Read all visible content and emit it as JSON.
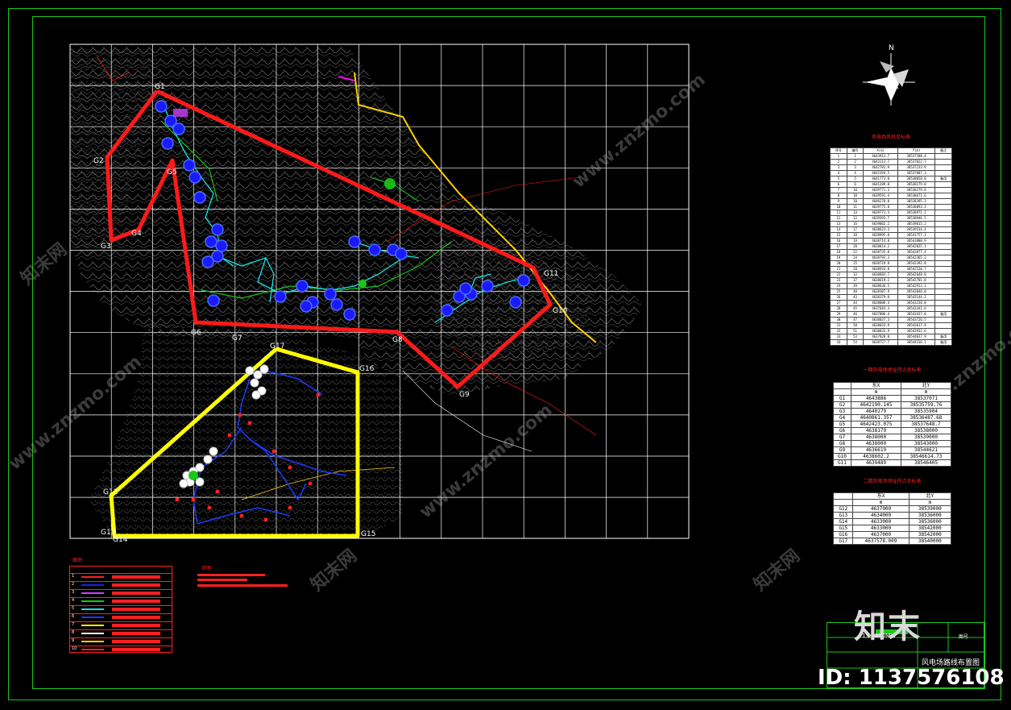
{
  "drawing": {
    "title": "风电场路线布置图",
    "corner_label": "图号",
    "scale_note": "1:10000MW"
  },
  "watermark": {
    "logo_text": "知末",
    "id_text": "ID: 1137576108",
    "site_text": "www.znzmo.com",
    "brand_text": "知末网"
  },
  "compass": {
    "north_label": "N"
  },
  "map_points": [
    {
      "id": "G1",
      "label": "G1"
    },
    {
      "id": "G2",
      "label": "G2"
    },
    {
      "id": "G3",
      "label": "G3"
    },
    {
      "id": "G4",
      "label": "G4"
    },
    {
      "id": "G5",
      "label": "G5"
    },
    {
      "id": "G6",
      "label": "G6"
    },
    {
      "id": "G7",
      "label": "G7"
    },
    {
      "id": "G8",
      "label": "G8"
    },
    {
      "id": "G9",
      "label": "G9"
    },
    {
      "id": "G10",
      "label": "G10"
    },
    {
      "id": "G11",
      "label": "G11"
    },
    {
      "id": "G12",
      "label": "G12"
    },
    {
      "id": "G13",
      "label": "G13"
    },
    {
      "id": "G14",
      "label": "G14"
    },
    {
      "id": "G15",
      "label": "G15"
    },
    {
      "id": "G16",
      "label": "G16"
    },
    {
      "id": "G17",
      "label": "G17"
    }
  ],
  "table1": {
    "title": "风电场风机坐标表",
    "headers": [
      "序号",
      "编号",
      "X(m)",
      "Y(m)",
      "备注"
    ],
    "rows": [
      [
        "1",
        "1",
        "4643913.7",
        "38537188.4",
        ""
      ],
      [
        "2",
        "2",
        "4643113.7",
        "38537022.7",
        ""
      ],
      [
        "3",
        "3",
        "4642781.9",
        "38537233.9",
        ""
      ],
      [
        "4",
        "4",
        "4642394.5",
        "38537807.3",
        ""
      ],
      [
        "5",
        "5",
        "4641773.0",
        "38538058.0",
        "备用"
      ],
      [
        "6",
        "6",
        "4641289.8",
        "38538179.0",
        ""
      ],
      [
        "7",
        "10",
        "4639771.3",
        "38538279.8",
        ""
      ],
      [
        "8",
        "10",
        "4639591.4",
        "38538671.6",
        ""
      ],
      [
        "9",
        "10",
        "4640270.0",
        "38538395.3",
        ""
      ],
      [
        "10",
        "11",
        "4639775.0",
        "38538893.3",
        ""
      ],
      [
        "11",
        "14",
        "4639771.3",
        "38538971.2",
        ""
      ],
      [
        "12",
        "12",
        "4639393.7",
        "38538946.5",
        ""
      ],
      [
        "13",
        "16",
        "4639002.2",
        "38539015.2",
        ""
      ],
      [
        "14",
        "17",
        "4638623.3",
        "38539534.4",
        ""
      ],
      [
        "15",
        "18",
        "4638995.0",
        "38541757.3",
        ""
      ],
      [
        "16",
        "19",
        "4638714.8",
        "38541800.9",
        ""
      ],
      [
        "17",
        "20",
        "4638814.2",
        "38542025.1",
        ""
      ],
      [
        "18",
        "22",
        "4638735.0",
        "38542077.4",
        ""
      ],
      [
        "19",
        "24",
        "4638793.3",
        "38542365.2",
        ""
      ],
      [
        "20",
        "25",
        "4638719.8",
        "38542392.8",
        ""
      ],
      [
        "21",
        "28",
        "4638933.8",
        "38542528.7",
        ""
      ],
      [
        "22",
        "33",
        "4638683.7",
        "38542648.8",
        ""
      ],
      [
        "23",
        "37",
        "4638619.2",
        "38542701.0",
        ""
      ],
      [
        "24",
        "39",
        "4638636.5",
        "38542913.1",
        ""
      ],
      [
        "25",
        "40",
        "4638307.9",
        "38543046.0",
        ""
      ],
      [
        "26",
        "43",
        "4638379.0",
        "38543144.2",
        ""
      ],
      [
        "27",
        "44",
        "4638008.4",
        "38543238.0",
        ""
      ],
      [
        "28",
        "45",
        "4637683.3",
        "38543341.6",
        ""
      ],
      [
        "29",
        "46",
        "4637806.4",
        "38543437.0",
        "备用"
      ],
      [
        "30",
        "47",
        "4638037.3",
        "38543726.5",
        ""
      ],
      [
        "31",
        "50",
        "4638033.9",
        "38543817.9",
        ""
      ],
      [
        "32",
        "51",
        "4638033.9",
        "38543932.6",
        ""
      ],
      [
        "33",
        "53",
        "4637828.0",
        "38544037.9",
        "备用"
      ],
      [
        "34",
        "54",
        "4638727.7",
        "38544316.1",
        "备用"
      ]
    ]
  },
  "table2": {
    "title": "一期风电场场址拐点坐标表",
    "headers": [
      "",
      "东X",
      "北Y"
    ],
    "units": [
      "",
      "m",
      "m"
    ],
    "rows": [
      [
        "G1",
        "4643886",
        "38537071"
      ],
      [
        "G2",
        "4642190.145",
        "38535759.76"
      ],
      [
        "G3",
        "4640279",
        "38535904"
      ],
      [
        "G4",
        "4640861.357",
        "38536487.68"
      ],
      [
        "G5",
        "4642423.075",
        "38537648.7"
      ],
      [
        "G6",
        "4638179",
        "38538000"
      ],
      [
        "G7",
        "4638000",
        "38539000"
      ],
      [
        "G8",
        "4638000",
        "38543000"
      ],
      [
        "G9",
        "4636619",
        "38544621"
      ],
      [
        "G10",
        "4638602.2",
        "38546614.73"
      ],
      [
        "G11",
        "4639489",
        "38546405"
      ]
    ]
  },
  "table3": {
    "title": "二期风电场场址拐点坐标表",
    "headers": [
      "",
      "东X",
      "北Y"
    ],
    "units": [
      "",
      "m",
      "m"
    ],
    "rows": [
      [
        "G12",
        "4637000",
        "38539000"
      ],
      [
        "G13",
        "4634000",
        "38536000"
      ],
      [
        "G14",
        "4633000",
        "38536000"
      ],
      [
        "G15",
        "4633000",
        "38542000"
      ],
      [
        "G16",
        "4637000",
        "38542000"
      ],
      [
        "G17",
        "4637578.009",
        "38540000"
      ]
    ]
  },
  "legend": {
    "title": "图例",
    "rows": [
      "1",
      "2",
      "3",
      "4",
      "5",
      "6",
      "7",
      "8",
      "9",
      "10"
    ]
  },
  "notes": {
    "title": "说明"
  },
  "colors": {
    "frame": "#19c919",
    "boundary_phase1": "#ff1a1a",
    "boundary_phase2": "#ffff00",
    "turbine_phase1": "#1a1aff",
    "turbine_phase2": "#ffffff",
    "cable_phase1": "#19e0e0",
    "cable_phase2": "#1a3cff",
    "road": "#ffd000",
    "grid": "#ffffff"
  }
}
